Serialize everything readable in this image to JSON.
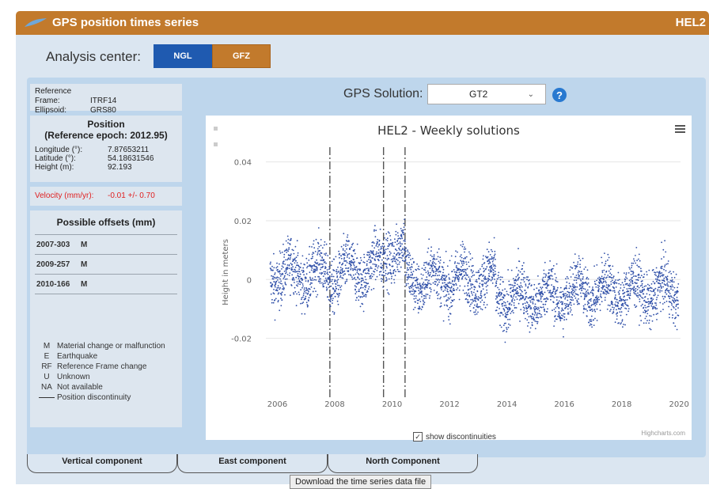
{
  "header": {
    "title": "GPS position times series",
    "station": "HEL2"
  },
  "analysis_center": {
    "label": "Analysis center:",
    "buttons": [
      "NGL",
      "GFZ"
    ]
  },
  "reference": {
    "frame_label": "Reference Frame:",
    "frame_value": "ITRF14",
    "ellipsoid_label": "Ellipsoid:",
    "ellipsoid_value": "GRS80"
  },
  "position": {
    "title": "Position",
    "epoch": "(Reference epoch: 2012.95)",
    "rows": [
      {
        "label": "Longitude (°):",
        "value": "7.87653211"
      },
      {
        "label": "Latitude (°):",
        "value": "54.18631546"
      },
      {
        "label": "Height (m):",
        "value": "92.193"
      }
    ]
  },
  "velocity": {
    "label": "Velocity (mm/yr):",
    "value": "-0.01 +/- 0.70",
    "color": "#e02020"
  },
  "offsets": {
    "title": "Possible offsets (mm)",
    "items": [
      {
        "date": "2007-303",
        "code": "M"
      },
      {
        "date": "2009-257",
        "code": "M"
      },
      {
        "date": "2010-166",
        "code": "M"
      }
    ]
  },
  "legend": [
    {
      "code": "M",
      "text": "Material change or malfunction"
    },
    {
      "code": "E",
      "text": "Earthquake"
    },
    {
      "code": "RF",
      "text": "Reference Frame change"
    },
    {
      "code": "U",
      "text": "Unknown"
    },
    {
      "code": "NA",
      "text": "Not available"
    },
    {
      "code": "",
      "text": "Position discontinuity"
    }
  ],
  "solution": {
    "label": "GPS Solution:",
    "value": "GT2"
  },
  "chart_data": {
    "type": "scatter",
    "title": "HEL2 - Weekly solutions",
    "ylabel": "Height in meters",
    "xlim": [
      2005.6,
      2020.05
    ],
    "ylim": [
      -0.04,
      0.045
    ],
    "x_ticks": [
      "2006",
      "2008",
      "2010",
      "2012",
      "2014",
      "2016",
      "2018",
      "2020"
    ],
    "y_ticks": [
      "0.04",
      "0.02",
      "0",
      "-0.02"
    ],
    "discontinuities": [
      2007.83,
      2009.7,
      2010.45
    ],
    "color": "#2f4fa8",
    "credit": "Highcharts.com"
  },
  "options": {
    "show_discontinuities": "show discontinuities",
    "checked": true
  },
  "tabs": [
    "Vertical component",
    "East component",
    "North Component"
  ],
  "download": "Download the time series data file"
}
